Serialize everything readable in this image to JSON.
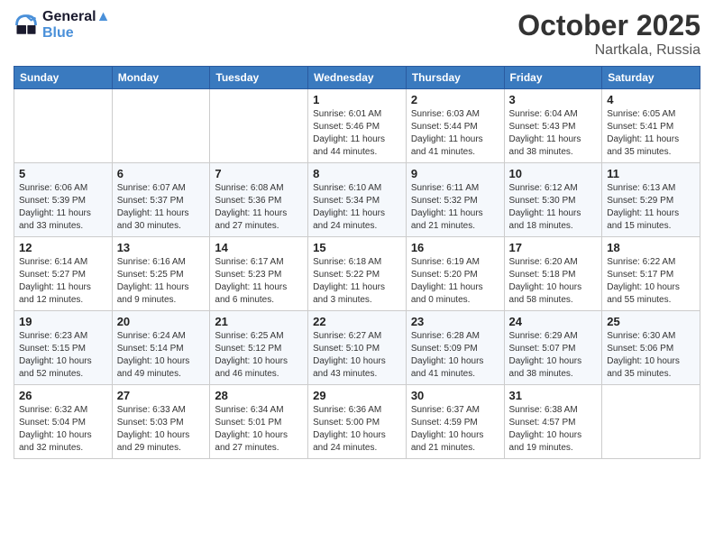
{
  "header": {
    "logo_line1": "General",
    "logo_line2": "Blue",
    "month_title": "October 2025",
    "location": "Nartkala, Russia"
  },
  "days_of_week": [
    "Sunday",
    "Monday",
    "Tuesday",
    "Wednesday",
    "Thursday",
    "Friday",
    "Saturday"
  ],
  "weeks": [
    [
      {
        "day": "",
        "info": ""
      },
      {
        "day": "",
        "info": ""
      },
      {
        "day": "",
        "info": ""
      },
      {
        "day": "1",
        "info": "Sunrise: 6:01 AM\nSunset: 5:46 PM\nDaylight: 11 hours and 44 minutes."
      },
      {
        "day": "2",
        "info": "Sunrise: 6:03 AM\nSunset: 5:44 PM\nDaylight: 11 hours and 41 minutes."
      },
      {
        "day": "3",
        "info": "Sunrise: 6:04 AM\nSunset: 5:43 PM\nDaylight: 11 hours and 38 minutes."
      },
      {
        "day": "4",
        "info": "Sunrise: 6:05 AM\nSunset: 5:41 PM\nDaylight: 11 hours and 35 minutes."
      }
    ],
    [
      {
        "day": "5",
        "info": "Sunrise: 6:06 AM\nSunset: 5:39 PM\nDaylight: 11 hours and 33 minutes."
      },
      {
        "day": "6",
        "info": "Sunrise: 6:07 AM\nSunset: 5:37 PM\nDaylight: 11 hours and 30 minutes."
      },
      {
        "day": "7",
        "info": "Sunrise: 6:08 AM\nSunset: 5:36 PM\nDaylight: 11 hours and 27 minutes."
      },
      {
        "day": "8",
        "info": "Sunrise: 6:10 AM\nSunset: 5:34 PM\nDaylight: 11 hours and 24 minutes."
      },
      {
        "day": "9",
        "info": "Sunrise: 6:11 AM\nSunset: 5:32 PM\nDaylight: 11 hours and 21 minutes."
      },
      {
        "day": "10",
        "info": "Sunrise: 6:12 AM\nSunset: 5:30 PM\nDaylight: 11 hours and 18 minutes."
      },
      {
        "day": "11",
        "info": "Sunrise: 6:13 AM\nSunset: 5:29 PM\nDaylight: 11 hours and 15 minutes."
      }
    ],
    [
      {
        "day": "12",
        "info": "Sunrise: 6:14 AM\nSunset: 5:27 PM\nDaylight: 11 hours and 12 minutes."
      },
      {
        "day": "13",
        "info": "Sunrise: 6:16 AM\nSunset: 5:25 PM\nDaylight: 11 hours and 9 minutes."
      },
      {
        "day": "14",
        "info": "Sunrise: 6:17 AM\nSunset: 5:23 PM\nDaylight: 11 hours and 6 minutes."
      },
      {
        "day": "15",
        "info": "Sunrise: 6:18 AM\nSunset: 5:22 PM\nDaylight: 11 hours and 3 minutes."
      },
      {
        "day": "16",
        "info": "Sunrise: 6:19 AM\nSunset: 5:20 PM\nDaylight: 11 hours and 0 minutes."
      },
      {
        "day": "17",
        "info": "Sunrise: 6:20 AM\nSunset: 5:18 PM\nDaylight: 10 hours and 58 minutes."
      },
      {
        "day": "18",
        "info": "Sunrise: 6:22 AM\nSunset: 5:17 PM\nDaylight: 10 hours and 55 minutes."
      }
    ],
    [
      {
        "day": "19",
        "info": "Sunrise: 6:23 AM\nSunset: 5:15 PM\nDaylight: 10 hours and 52 minutes."
      },
      {
        "day": "20",
        "info": "Sunrise: 6:24 AM\nSunset: 5:14 PM\nDaylight: 10 hours and 49 minutes."
      },
      {
        "day": "21",
        "info": "Sunrise: 6:25 AM\nSunset: 5:12 PM\nDaylight: 10 hours and 46 minutes."
      },
      {
        "day": "22",
        "info": "Sunrise: 6:27 AM\nSunset: 5:10 PM\nDaylight: 10 hours and 43 minutes."
      },
      {
        "day": "23",
        "info": "Sunrise: 6:28 AM\nSunset: 5:09 PM\nDaylight: 10 hours and 41 minutes."
      },
      {
        "day": "24",
        "info": "Sunrise: 6:29 AM\nSunset: 5:07 PM\nDaylight: 10 hours and 38 minutes."
      },
      {
        "day": "25",
        "info": "Sunrise: 6:30 AM\nSunset: 5:06 PM\nDaylight: 10 hours and 35 minutes."
      }
    ],
    [
      {
        "day": "26",
        "info": "Sunrise: 6:32 AM\nSunset: 5:04 PM\nDaylight: 10 hours and 32 minutes."
      },
      {
        "day": "27",
        "info": "Sunrise: 6:33 AM\nSunset: 5:03 PM\nDaylight: 10 hours and 29 minutes."
      },
      {
        "day": "28",
        "info": "Sunrise: 6:34 AM\nSunset: 5:01 PM\nDaylight: 10 hours and 27 minutes."
      },
      {
        "day": "29",
        "info": "Sunrise: 6:36 AM\nSunset: 5:00 PM\nDaylight: 10 hours and 24 minutes."
      },
      {
        "day": "30",
        "info": "Sunrise: 6:37 AM\nSunset: 4:59 PM\nDaylight: 10 hours and 21 minutes."
      },
      {
        "day": "31",
        "info": "Sunrise: 6:38 AM\nSunset: 4:57 PM\nDaylight: 10 hours and 19 minutes."
      },
      {
        "day": "",
        "info": ""
      }
    ]
  ]
}
